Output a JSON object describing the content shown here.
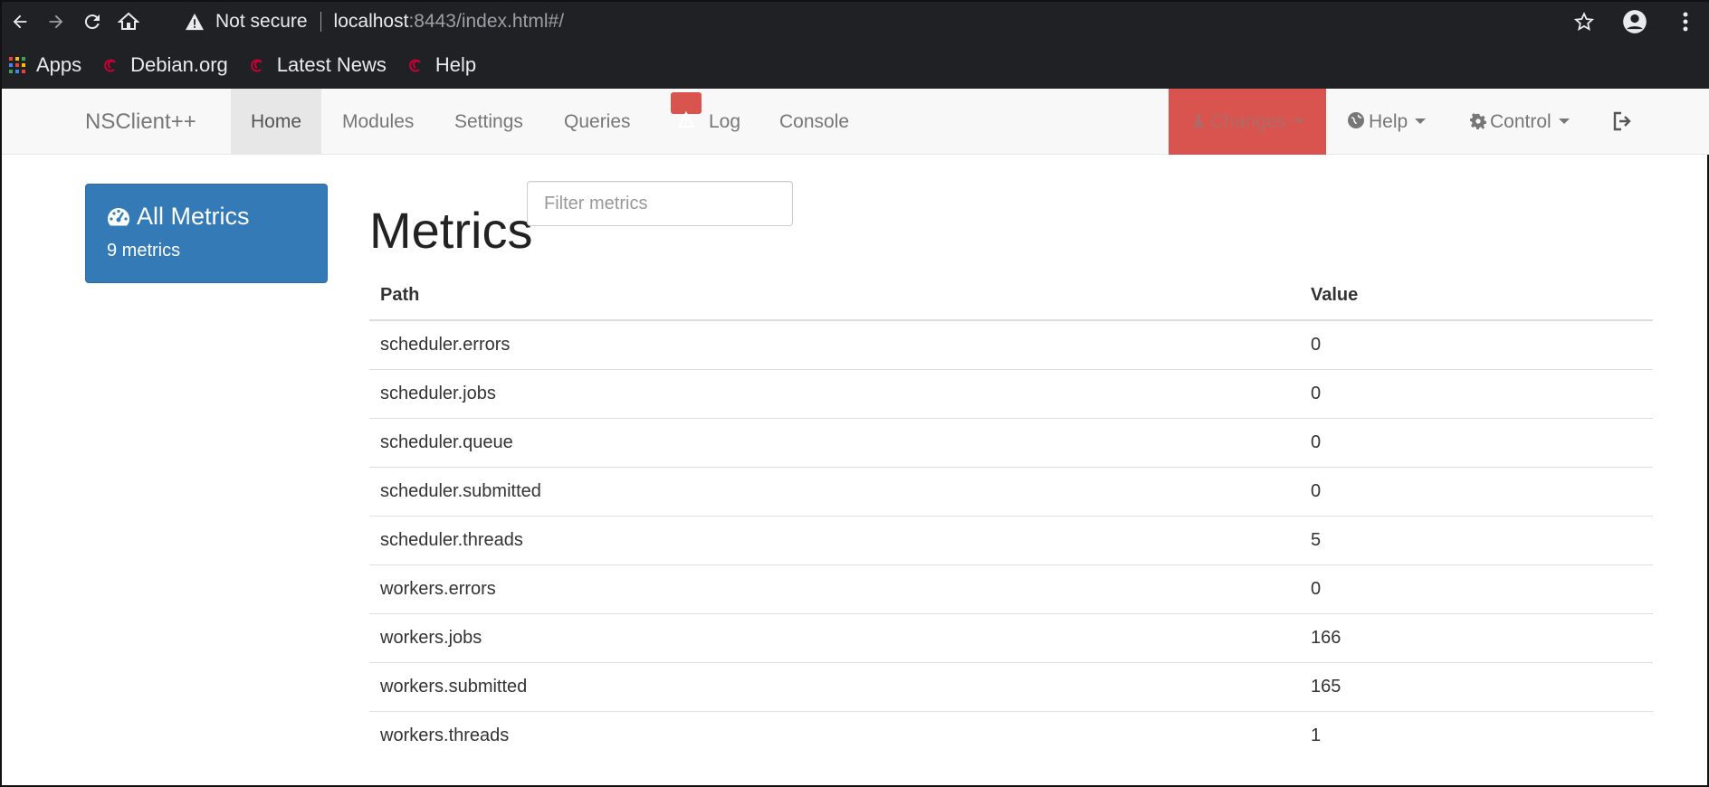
{
  "browser": {
    "security_label": "Not secure",
    "url_host": "localhost",
    "url_rest": ":8443/index.html#/",
    "bookmarks": [
      {
        "label": "Apps",
        "icon": "apps-grid-icon"
      },
      {
        "label": "Debian.org",
        "icon": "debian-swirl-icon"
      },
      {
        "label": "Latest News",
        "icon": "debian-swirl-icon"
      },
      {
        "label": "Help",
        "icon": "debian-swirl-icon"
      }
    ]
  },
  "navbar": {
    "brand": "NSClient++",
    "items": {
      "home": "Home",
      "modules": "Modules",
      "settings": "Settings",
      "queries": "Queries",
      "log": "Log",
      "console": "Console"
    },
    "changes": "Changes",
    "help": "Help",
    "control": "Control"
  },
  "sidebar": {
    "title": "All Metrics",
    "subtitle": "9 metrics"
  },
  "main": {
    "title": "Metrics",
    "filter_placeholder": "Filter metrics",
    "columns": [
      "Path",
      "Value"
    ],
    "rows": [
      {
        "path": "scheduler.errors",
        "value": "0"
      },
      {
        "path": "scheduler.jobs",
        "value": "0"
      },
      {
        "path": "scheduler.queue",
        "value": "0"
      },
      {
        "path": "scheduler.submitted",
        "value": "0"
      },
      {
        "path": "scheduler.threads",
        "value": "5"
      },
      {
        "path": "workers.errors",
        "value": "0"
      },
      {
        "path": "workers.jobs",
        "value": "166"
      },
      {
        "path": "workers.submitted",
        "value": "165"
      },
      {
        "path": "workers.threads",
        "value": "1"
      }
    ]
  },
  "colors": {
    "primary": "#337ab7",
    "danger": "#d9534f",
    "chrome_bg": "#202124"
  }
}
